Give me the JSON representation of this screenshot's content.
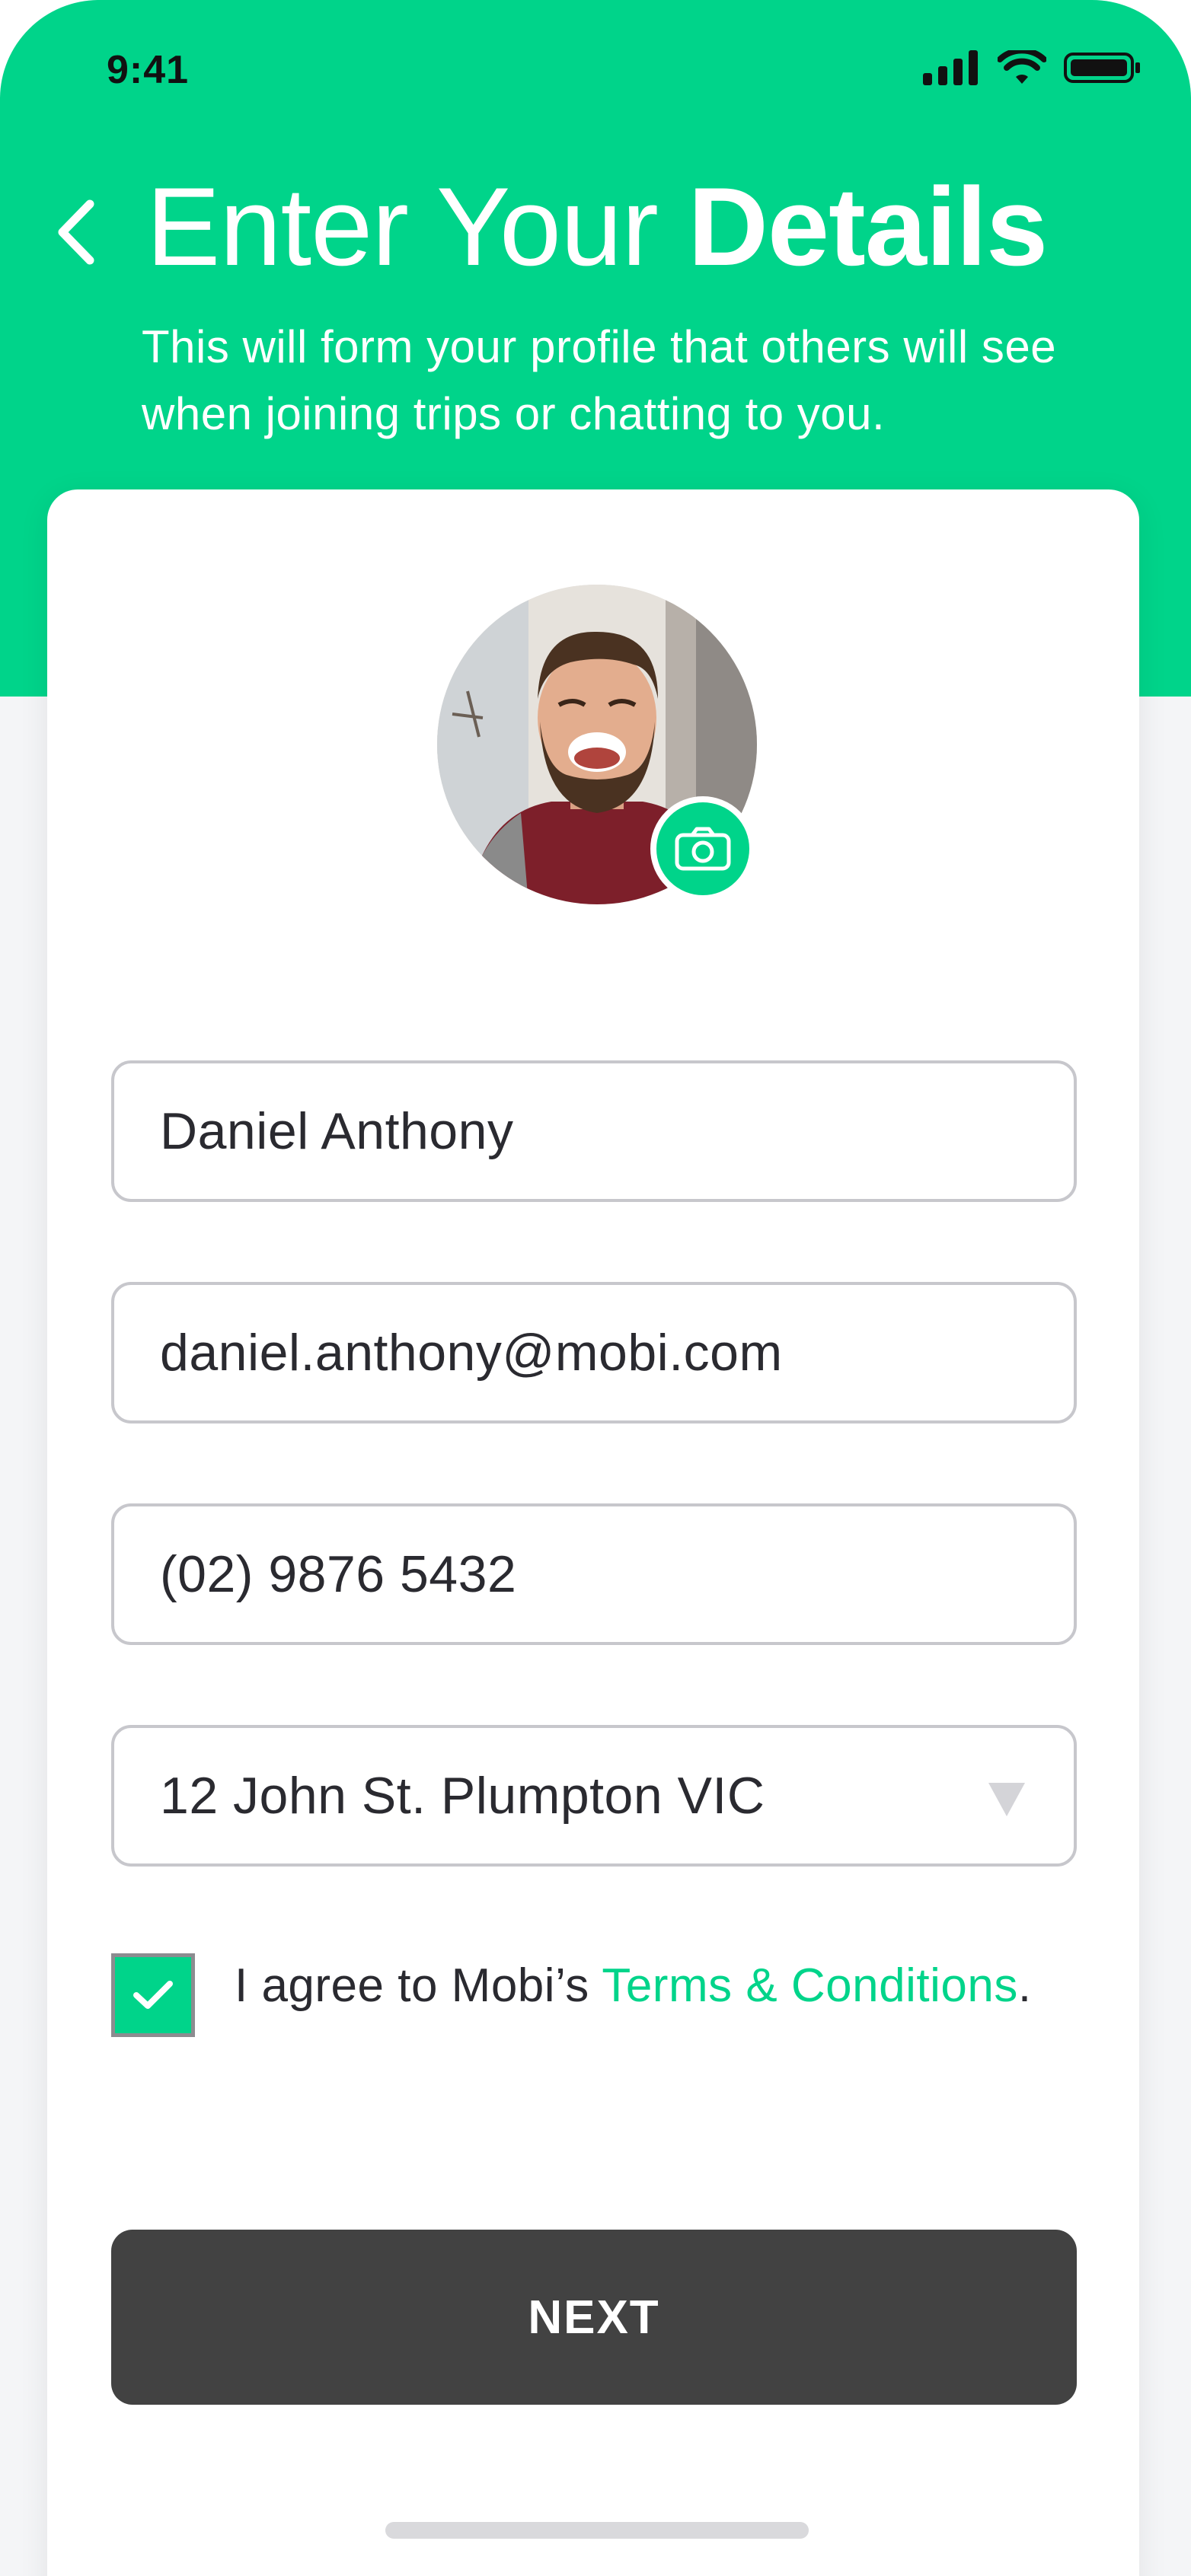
{
  "status_bar": {
    "time": "9:41",
    "icons": [
      "signal-icon",
      "wifi-icon",
      "battery-icon"
    ]
  },
  "header": {
    "back_icon": "chevron-left-icon",
    "title_regular": "Enter Your ",
    "title_bold": "Details",
    "subtitle": "This will form your profile that others will see when joining trips or chatting to you."
  },
  "profile": {
    "avatar": "profile-photo",
    "camera_icon": "camera-icon"
  },
  "form": {
    "name_value": "Daniel Anthony",
    "email_value": "daniel.anthony@mobi.com",
    "phone_value": "(02) 9876 5432",
    "address_value": "12 John St. Plumpton VIC",
    "address_arrow_icon": "dropdown-arrow-icon"
  },
  "agreement": {
    "checked": true,
    "text_prefix": "I agree to Mobi’s ",
    "link_text": "Terms & Conditions",
    "text_suffix": "."
  },
  "actions": {
    "next_label": "NEXT"
  },
  "colors": {
    "accent": "#00d48a",
    "button_dark": "#424242",
    "text": "#2a2a30",
    "border": "#c7c7cc"
  }
}
